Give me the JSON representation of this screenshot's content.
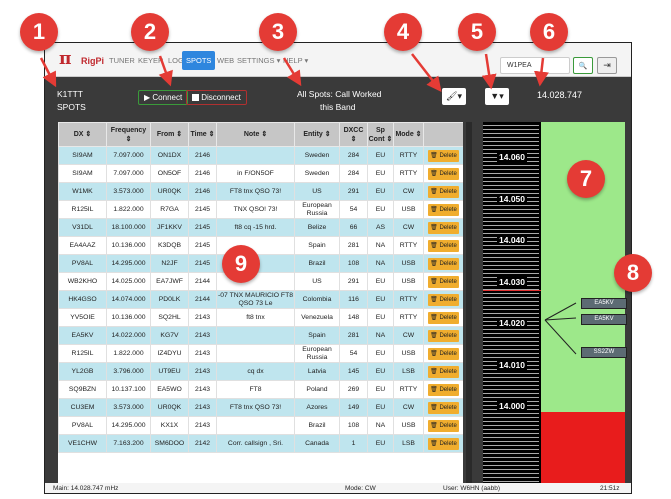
{
  "app": {
    "logo": "π",
    "brand": "RigPi"
  },
  "nav": {
    "items": [
      "TUNER",
      "KEYER",
      "LOG",
      "SPOTS",
      "WEB",
      "SETTINGS ▾",
      "HELP ▾"
    ],
    "active": "SPOTS"
  },
  "search": {
    "callsign": "W1PEA",
    "search_icon": "🔍",
    "exit_icon": "⇥"
  },
  "status": {
    "callsign": "K1TTT",
    "page": "SPOTS",
    "connect_label": "Connect",
    "disconnect_label": "Disconnect",
    "filter_line1": "All Spots: Call Worked",
    "filter_line2": "this Band",
    "frequency": "14.028.747"
  },
  "table": {
    "headers": [
      "DX ⇕",
      "Frequency ⇕",
      "From ⇕",
      "Time ⇕",
      "Note ⇕",
      "Entity ⇕",
      "DXCC ⇕",
      "Sp Cont ⇕",
      "Mode ⇕",
      ""
    ],
    "delete_label": "Delete",
    "rows": [
      [
        "SI9AM",
        "7.097.000",
        "ON1DX",
        "2146",
        "",
        "Sweden",
        "284",
        "EU",
        "RTTY"
      ],
      [
        "SI9AM",
        "7.097.000",
        "ON5OF",
        "2146",
        "in F/ON5OF",
        "Sweden",
        "284",
        "EU",
        "RTTY"
      ],
      [
        "W1MK",
        "3.573.000",
        "UR0QK",
        "2146",
        "FT8 tnx QSO 73!",
        "US",
        "291",
        "EU",
        "CW"
      ],
      [
        "R125IL",
        "1.822.000",
        "R7GA",
        "2145",
        "TNX QSO! 73!",
        "European Russia",
        "54",
        "EU",
        "USB"
      ],
      [
        "V31DL",
        "18.100.000",
        "JF1KKV",
        "2145",
        "ft8 cq -15 hrd.",
        "Belize",
        "66",
        "AS",
        "CW"
      ],
      [
        "EA4AAZ",
        "10.136.000",
        "K3DQB",
        "2145",
        "",
        "Spain",
        "281",
        "NA",
        "RTTY"
      ],
      [
        "PV8AL",
        "14.295.000",
        "N2JF",
        "2145",
        "",
        "Brazil",
        "108",
        "NA",
        "USB"
      ],
      [
        "WB2KHO",
        "14.025.000",
        "EA7JWF",
        "2144",
        "",
        "US",
        "291",
        "EU",
        "USB"
      ],
      [
        "HK4GSO",
        "14.074.000",
        "PD0LK",
        "2144",
        "-07 TNX MAURICIO FT8 QSO 73 Le",
        "Colombia",
        "116",
        "EU",
        "RTTY"
      ],
      [
        "YV5OIE",
        "10.136.000",
        "SQ2HL",
        "2143",
        "ft8 tnx",
        "Venezuela",
        "148",
        "EU",
        "RTTY"
      ],
      [
        "EA5KV",
        "14.022.000",
        "KG7V",
        "2143",
        "",
        "Spain",
        "281",
        "NA",
        "CW"
      ],
      [
        "R125IL",
        "1.822.000",
        "IZ4DYU",
        "2143",
        "",
        "European Russia",
        "54",
        "EU",
        "USB"
      ],
      [
        "YL2GB",
        "3.796.000",
        "UT9EU",
        "2143",
        "cq dx",
        "Latvia",
        "145",
        "EU",
        "LSB"
      ],
      [
        "SQ9BZN",
        "10.137.100",
        "EA5WO",
        "2143",
        "FT8",
        "Poland",
        "269",
        "EU",
        "RTTY"
      ],
      [
        "CU3EM",
        "3.573.000",
        "UR0QK",
        "2143",
        "FT8 tnx QSO 73!",
        "Azores",
        "149",
        "EU",
        "CW"
      ],
      [
        "PV8AL",
        "14.295.000",
        "KX1X",
        "2143",
        "",
        "Brazil",
        "108",
        "NA",
        "USB"
      ],
      [
        "VE1CHW",
        "7.163.200",
        "SM6DOO",
        "2142",
        "Corr. callsign , Sri.",
        "Canada",
        "1",
        "EU",
        "LSB"
      ]
    ]
  },
  "bandmap": {
    "labels": [
      "14.060",
      "14.050",
      "14.040",
      "14.030",
      "14.020",
      "14.010",
      "14.000"
    ],
    "spots": [
      "EA5KV",
      "EA5KV",
      "SS2ZW"
    ]
  },
  "footer": {
    "main": "Main: 14.028.747 mHz",
    "mode": "Mode: CW",
    "user": "User: W6HN (aabb)",
    "time": "21:51z"
  },
  "callouts": [
    "1",
    "2",
    "3",
    "4",
    "5",
    "6",
    "7",
    "8",
    "9"
  ],
  "colors": {
    "callout": "#e43b35",
    "active_nav": "#2e86de",
    "band_green": "#9de88a",
    "band_red": "#e81c1c",
    "row_alt": "#bfe5ee",
    "delete": "#f0ad2e"
  }
}
